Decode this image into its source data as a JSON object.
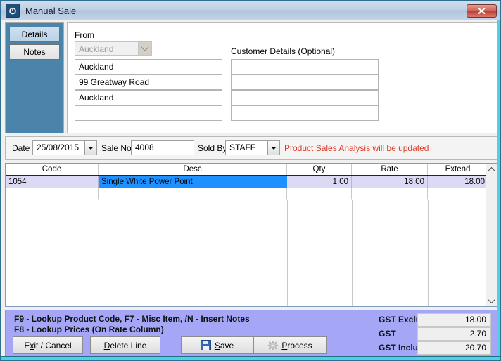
{
  "window": {
    "title": "Manual Sale",
    "app_icon": "power-icon",
    "close_label": "✕"
  },
  "sidebar": {
    "items": [
      {
        "label": "Details",
        "active": true
      },
      {
        "label": "Notes",
        "active": false
      }
    ]
  },
  "form": {
    "from_label": "From",
    "from_combo_value": "Auckland",
    "from_lines": [
      "Auckland",
      "99 Greatway Road",
      "Auckland",
      ""
    ],
    "customer_label": "Customer Details (Optional)",
    "customer_lines": [
      "",
      "",
      "",
      ""
    ]
  },
  "header_strip": {
    "date_label": "Date",
    "date_value": "25/08/2015",
    "sale_no_label": "Sale No.",
    "sale_no_value": "4008",
    "sold_by_label": "Sold By",
    "sold_by_value": "STAFF",
    "analysis_note": "Product Sales Analysis will be updated",
    "analysis_note_color": "#e03a25"
  },
  "grid": {
    "columns": [
      "Code",
      "Desc",
      "Qty",
      "Rate",
      "Extend"
    ],
    "rows": [
      {
        "code": "1054",
        "desc": "Single White Power Point",
        "qty": "1.00",
        "rate": "18.00",
        "extend": "18.00",
        "selected": true,
        "desc_highlighted": true
      }
    ],
    "scroll_up_icon": "chevron-up-icon",
    "scroll_down_icon": "chevron-down-icon"
  },
  "footer": {
    "hint_line_1": "F9 - Lookup Product Code,     F7 - Misc Item,   /N - Insert Notes",
    "hint_line_2": "F8 - Lookup Prices (On Rate Column)",
    "buttons": [
      {
        "name": "exit-cancel",
        "pre": "E",
        "accel": "x",
        "post": "it / Cancel",
        "icon": null
      },
      {
        "name": "delete-line",
        "pre": "",
        "accel": "D",
        "post": "elete Line",
        "icon": null
      },
      {
        "name": "save",
        "pre": "",
        "accel": "S",
        "post": "ave",
        "icon": "floppy-disk-icon"
      },
      {
        "name": "process",
        "pre": "",
        "accel": "P",
        "post": "rocess",
        "icon": "gear-icon"
      }
    ],
    "totals": [
      {
        "label": "GST Exclusive",
        "value": "18.00"
      },
      {
        "label": "GST",
        "value": "2.70"
      },
      {
        "label": "GST Inclusive",
        "value": "20.70"
      }
    ]
  },
  "colors": {
    "sidebar_bg": "#4a84ab",
    "footer_bg": "#a6a6f7",
    "selection_blue": "#1e90ff",
    "row_selected": "#dcd9f4",
    "accent_cyan": "#4fd0e4"
  }
}
